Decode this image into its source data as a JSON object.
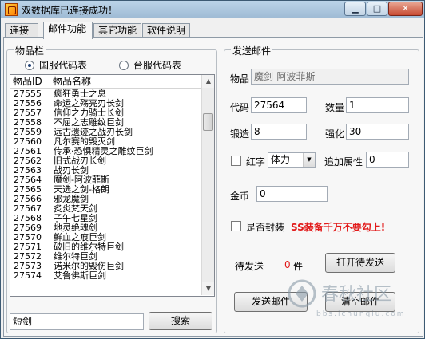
{
  "window": {
    "title": "双数据库已连接成功！"
  },
  "tabs": [
    {
      "label": "连接"
    },
    {
      "label": "邮件功能"
    },
    {
      "label": "其它功能"
    },
    {
      "label": "软件说明"
    }
  ],
  "items_group": {
    "title": "物品栏",
    "radio_cn": "国服代码表",
    "radio_tw": "台服代码表",
    "selected": "国服代码表",
    "columns": [
      "物品ID",
      "物品名称"
    ],
    "rows": [
      {
        "id": "27555",
        "name": "疯狂勇士之息"
      },
      {
        "id": "27556",
        "name": "命运之殇亮刃长剑"
      },
      {
        "id": "27557",
        "name": "信仰之力骑士长剑"
      },
      {
        "id": "27558",
        "name": "不屈之志雕纹巨剑"
      },
      {
        "id": "27559",
        "name": "远古遗迹之战刃长剑"
      },
      {
        "id": "27560",
        "name": "凡尔赛的毁灭剑"
      },
      {
        "id": "27561",
        "name": "传承·恐惧精灵之雕纹巨剑"
      },
      {
        "id": "27562",
        "name": "旧式战刃长剑"
      },
      {
        "id": "27563",
        "name": "战刃长剑"
      },
      {
        "id": "27564",
        "name": "魔剑-阿波菲斯"
      },
      {
        "id": "27565",
        "name": "天选之剑-格朗"
      },
      {
        "id": "27566",
        "name": "邪龙魔剑"
      },
      {
        "id": "27567",
        "name": "炙炎梵天剑"
      },
      {
        "id": "27568",
        "name": "子午七星剑"
      },
      {
        "id": "27569",
        "name": "地灵绝魂剑"
      },
      {
        "id": "27570",
        "name": "鲜血之痕巨剑"
      },
      {
        "id": "27571",
        "name": "破旧的维尔特巨剑"
      },
      {
        "id": "27572",
        "name": "维尔特巨剑"
      },
      {
        "id": "27573",
        "name": "诺米尔的毁伤巨剑"
      },
      {
        "id": "27574",
        "name": "艾鲁佛斯巨剑"
      }
    ],
    "search_value": "短剑",
    "search_button": "搜索"
  },
  "mail_group": {
    "title": "发送邮件",
    "item_label": "物品",
    "item_value": "魔剑-阿波菲斯",
    "code_label": "代码",
    "code_value": "27564",
    "qty_label": "数量",
    "qty_value": "1",
    "forge_label": "锻造",
    "forge_value": "8",
    "enhance_label": "强化",
    "enhance_value": "30",
    "redtext_label": "红字",
    "redtext_select": "体力",
    "extra_label": "追加属性",
    "extra_value": "0",
    "gold_label": "金币",
    "gold_value": "0",
    "seal_label": "是否封装",
    "seal_warning": "SS装备千万不要勾上!",
    "pending_label": "待发送",
    "pending_count": "0",
    "pending_unit": "件",
    "open_pending_button": "打开待发送",
    "send_button": "发送邮件",
    "clear_button": "清空邮件"
  },
  "watermark": {
    "text": "春秋社区",
    "url": "bbs.ichunqiu.com"
  },
  "colors": {
    "warning": "#e21a1a",
    "titlebar": "#bcd4e8"
  }
}
